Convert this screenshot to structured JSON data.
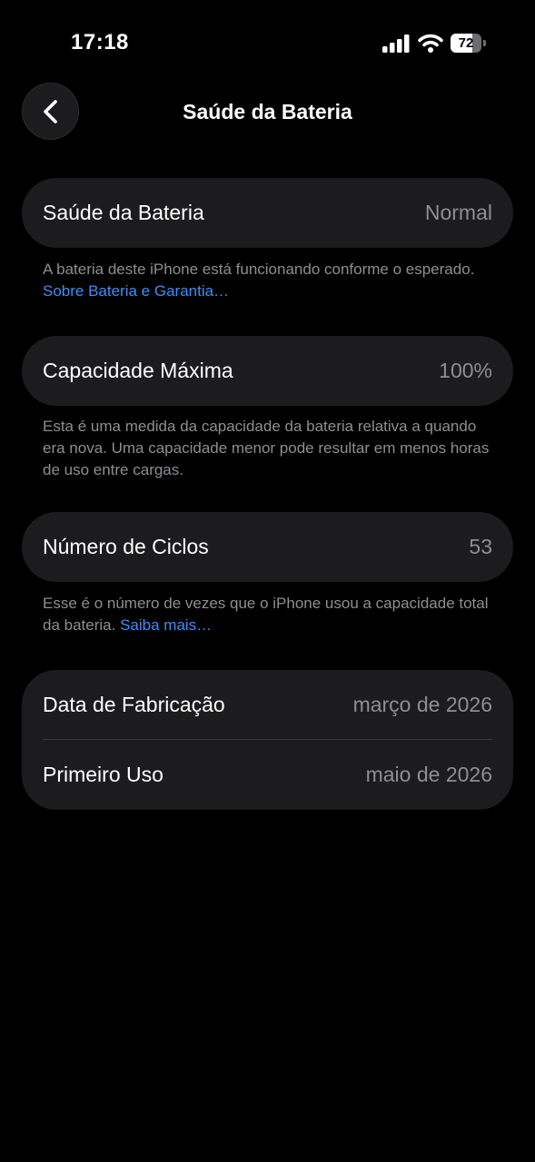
{
  "status_bar": {
    "time": "17:18",
    "battery_level": "72",
    "battery_percent": 72,
    "icons": [
      "cellular-signal-icon",
      "wifi-icon",
      "battery-icon"
    ]
  },
  "nav": {
    "title": "Saúde da Bateria",
    "back_icon": "chevron-left-icon"
  },
  "battery_health": {
    "label": "Saúde da Bateria",
    "value": "Normal",
    "footnote": "A bateria deste iPhone está funcionando conforme o esperado.",
    "footnote_link": "Sobre Bateria e Garantia…"
  },
  "max_capacity": {
    "label": "Capacidade Máxima",
    "value": "100%",
    "footnote": "Esta é uma medida da capacidade da bateria relativa a quando era nova. Uma capacidade menor pode resultar em menos horas de uso entre cargas."
  },
  "cycle_count": {
    "label": "Número de Ciclos",
    "value": "53",
    "footnote": "Esse é o número de vezes que o iPhone usou a capacidade total da bateria.",
    "footnote_link": "Saiba mais…"
  },
  "dates": {
    "manufacture_label": "Data de Fabricação",
    "manufacture_value": "março de 2026",
    "first_use_label": "Primeiro Uso",
    "first_use_value": "maio de 2026"
  },
  "colors": {
    "background": "#000000",
    "cell": "#1c1c1e",
    "secondary_text": "#8e8e93",
    "link": "#3e8ef7"
  }
}
